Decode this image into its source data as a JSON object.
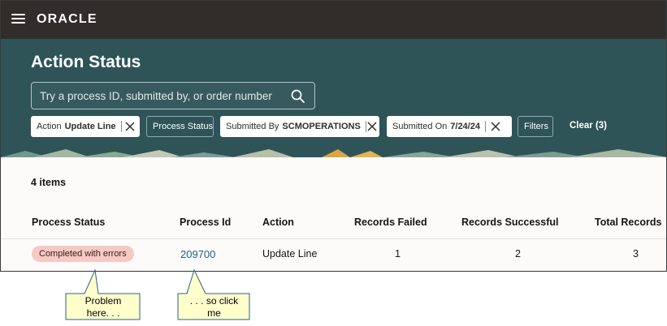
{
  "header": {
    "logo": "ORACLE"
  },
  "page": {
    "title": "Action Status"
  },
  "search": {
    "placeholder": "Try a process ID, submitted by, or order number"
  },
  "filters": [
    {
      "label": "Action",
      "value": "Update Line"
    },
    {
      "label": "Process Status"
    },
    {
      "label": "Submitted By",
      "value": "SCMOPERATIONS"
    },
    {
      "label": "Submitted On",
      "value": "7/24/24"
    },
    {
      "label": "Filters"
    }
  ],
  "clear_label": "Clear (3)",
  "results": {
    "count": "4 items",
    "columns": [
      "Process Status",
      "Process Id",
      "Action",
      "Records Failed",
      "Records Successful",
      "Total Records"
    ],
    "rows": [
      {
        "status": "Completed with errors",
        "process_id": "209700",
        "action": "Update Line",
        "failed": "1",
        "successful": "2",
        "total": "3"
      }
    ]
  },
  "callouts": [
    {
      "lines": [
        "Problem",
        "here. . ."
      ]
    },
    {
      "lines": [
        ". . . so click",
        "me"
      ]
    }
  ],
  "colors": {
    "topbar": "#312d2a",
    "banner": "#2e5458",
    "badge_error": "#f7c9c4",
    "link": "#1e6280",
    "callout_fill": "#ffffcc",
    "callout_border": "#2f5f82"
  }
}
